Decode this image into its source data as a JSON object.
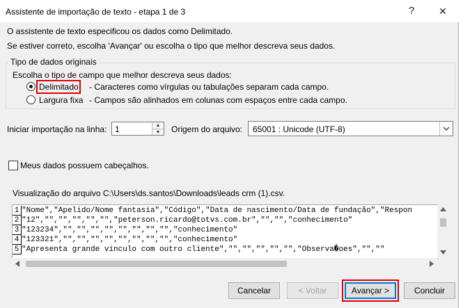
{
  "window": {
    "title": "Assistente de importação de texto - etapa 1 de 3",
    "help": "?",
    "close": "✕"
  },
  "intro": {
    "line1": "O assistente de texto especificou os dados como Delimitado.",
    "line2": "Se estiver correto, escolha 'Avançar' ou escolha o tipo que melhor descreva seus dados."
  },
  "group": {
    "legend": "Tipo de dados originais",
    "prompt": "Escolha o tipo de campo que melhor descreva seus dados:",
    "options": [
      {
        "label": "Delimitado",
        "desc": "- Caracteres como vírgulas ou tabulações separam cada campo.",
        "selected": true
      },
      {
        "label": "Largura fixa",
        "desc": "- Campos são alinhados em colunas com espaços entre cada campo.",
        "selected": false
      }
    ]
  },
  "start_row": {
    "label": "Iniciar importação na linha:",
    "value": "1"
  },
  "origin": {
    "label": "Origem do arquivo:",
    "value": "65001 : Unicode (UTF-8)"
  },
  "headers_checkbox": {
    "label": "Meus dados possuem cabeçalhos.",
    "checked": false
  },
  "preview": {
    "title": "Visualização do arquivo C:\\Users\\ds.santos\\Downloads\\leads crm (1).csv.",
    "lines": [
      {
        "num": "1",
        "text": "\"Nome\",\"Apelido/Nome fantasia\",\"Código\",\"Data de nascimento/Data de fundação\",\"Respon"
      },
      {
        "num": "2",
        "text": "\"12\",\"\",\"\",\"\",\"\",\"\",\"peterson.ricardo@totvs.com.br\",\"\",\"\",\"conhecimento\""
      },
      {
        "num": "3",
        "text": "\"123234\",\"\",\"\",\"\",\"\",\"\",\"\",\"\",\"\",\"conhecimento\""
      },
      {
        "num": "4",
        "text": "\"123321\",\"\",\"\",\"\",\"\",\"\",\"\",\"\",\"\",\"conhecimento\""
      },
      {
        "num": "5",
        "text": "\"Apresenta grande vinculo com outro cliente\",\"\",\"\",\"\",\"\",\"\",\"Observa�oes\",\"\",\"\""
      }
    ]
  },
  "buttons": {
    "cancel": "Cancelar",
    "back": "< Voltar",
    "next": "Avançar >",
    "finish": "Concluir"
  },
  "colors": {
    "highlight": "#e00000",
    "focus": "#0078d7"
  }
}
